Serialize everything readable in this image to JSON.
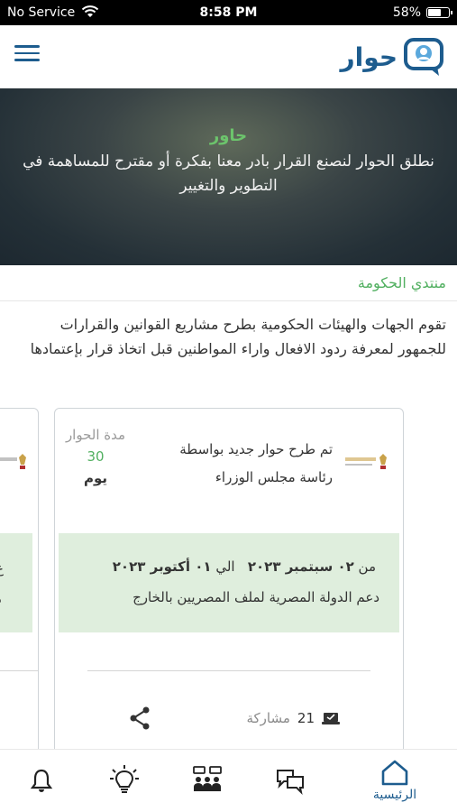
{
  "status_bar": {
    "carrier": "No Service",
    "time": "8:58 PM",
    "battery": "58%"
  },
  "header": {
    "brand": "حوار"
  },
  "hero": {
    "title": "حاور",
    "description": "نطلق الحوار لنصنع القرار بادر معنا بفكرة أو مقترح للمساهمة في التطوير والتغيير"
  },
  "section": {
    "title": "منتدي الحكومة",
    "description": "تقوم الجهات والهيئات الحكومية بطرح مشاريع القوانين والقرارات للجمهور لمعرفة ردود الافعال واراء المواطنين قبل اتخاذ قرار بإعتمادها"
  },
  "card": {
    "posted_line1": "تم طرح حوار جديد بواسطة",
    "posted_line2": "رئاسة مجلس الوزراء",
    "duration_label": "مدة الحوار",
    "duration_value": "30",
    "duration_unit": "يوم",
    "date_from_word": "من",
    "date_from": "٠٢ سبتمبر ٢٠٢٣",
    "date_to_word": "الي",
    "date_to": "٠١ أكتوبر ٢٠٢٣",
    "topic": "دعم الدولة المصرية لملف المصريين بالخارج",
    "participants_count": "21",
    "participants_label": "مشاركة"
  },
  "peek_card": {
    "letter1": "ع",
    "letter2": "د"
  },
  "bottom_nav": {
    "home_label": "الرئيسية"
  },
  "colors": {
    "brand_blue": "#1d5c8e",
    "accent_green": "#52b061",
    "card_green_bg": "#dfeedd"
  }
}
